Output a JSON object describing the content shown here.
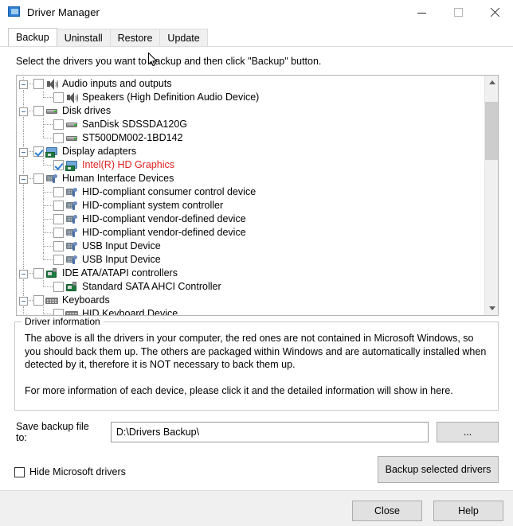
{
  "window": {
    "title": "Driver Manager",
    "icon": "app-window-icon",
    "controls": {
      "minimize": "minimize-icon",
      "maximize": "maximize-icon",
      "close": "close-icon"
    }
  },
  "tabs": [
    {
      "label": "Backup",
      "active": true
    },
    {
      "label": "Uninstall",
      "active": false
    },
    {
      "label": "Restore",
      "active": false
    },
    {
      "label": "Update",
      "active": false
    }
  ],
  "instruction": "Select the drivers you want to backup and then click \"Backup\" button.",
  "tree": {
    "rows": [
      {
        "label": "Audio inputs and outputs",
        "level": 0,
        "checked": false,
        "icon": "speaker-icon",
        "red": false,
        "expander": true
      },
      {
        "label": "Speakers (High Definition Audio Device)",
        "level": 1,
        "checked": false,
        "icon": "speaker-icon",
        "red": false,
        "expander": false
      },
      {
        "label": "Disk drives",
        "level": 0,
        "checked": false,
        "icon": "disk-icon",
        "red": false,
        "expander": true
      },
      {
        "label": "SanDisk SDSSDA120G",
        "level": 1,
        "checked": false,
        "icon": "disk-icon",
        "red": false,
        "expander": false
      },
      {
        "label": "ST500DM002-1BD142",
        "level": 1,
        "checked": false,
        "icon": "disk-icon",
        "red": false,
        "expander": false
      },
      {
        "label": "Display adapters",
        "level": 0,
        "checked": true,
        "icon": "display-adapter-icon",
        "red": false,
        "expander": true
      },
      {
        "label": "Intel(R) HD Graphics",
        "level": 1,
        "checked": true,
        "icon": "display-adapter-icon",
        "red": true,
        "expander": false
      },
      {
        "label": "Human Interface Devices",
        "level": 0,
        "checked": false,
        "icon": "hid-icon",
        "red": false,
        "expander": true
      },
      {
        "label": "HID-compliant consumer control device",
        "level": 1,
        "checked": false,
        "icon": "hid-icon",
        "red": false,
        "expander": false
      },
      {
        "label": "HID-compliant system controller",
        "level": 1,
        "checked": false,
        "icon": "hid-icon",
        "red": false,
        "expander": false
      },
      {
        "label": "HID-compliant vendor-defined device",
        "level": 1,
        "checked": false,
        "icon": "hid-icon",
        "red": false,
        "expander": false
      },
      {
        "label": "HID-compliant vendor-defined device",
        "level": 1,
        "checked": false,
        "icon": "hid-icon",
        "red": false,
        "expander": false
      },
      {
        "label": "USB Input Device",
        "level": 1,
        "checked": false,
        "icon": "hid-icon",
        "red": false,
        "expander": false
      },
      {
        "label": "USB Input Device",
        "level": 1,
        "checked": false,
        "icon": "hid-icon",
        "red": false,
        "expander": false
      },
      {
        "label": "IDE ATA/ATAPI controllers",
        "level": 0,
        "checked": false,
        "icon": "ide-controller-icon",
        "red": false,
        "expander": true
      },
      {
        "label": "Standard SATA AHCI Controller",
        "level": 1,
        "checked": false,
        "icon": "ide-controller-icon",
        "red": false,
        "expander": false
      },
      {
        "label": "Keyboards",
        "level": 0,
        "checked": false,
        "icon": "keyboard-icon",
        "red": false,
        "expander": true
      },
      {
        "label": "HID Keyboard Device",
        "level": 1,
        "checked": false,
        "icon": "keyboard-icon",
        "red": false,
        "expander": false
      }
    ],
    "scroll": {
      "up_arrow": "scroll-up-icon",
      "down_arrow": "scroll-down-icon",
      "thumb_top_pct": 6,
      "thumb_height_pct": 16
    }
  },
  "driver_information": {
    "legend": "Driver information",
    "paragraph1": "The above is all the drivers in your computer, the red ones are not contained in Microsoft Windows, so you should back them up. The others are packaged within Windows and are automatically installed when detected by it, therefore it is NOT necessary to back them up.",
    "paragraph2": "For more information of each device, please click it and the detailed information will show in here."
  },
  "save_row": {
    "label": "Save backup file to:",
    "path_value": "D:\\Drivers Backup\\",
    "path_placeholder": "",
    "browse_label": "..."
  },
  "options": {
    "hide_microsoft_label": "Hide Microsoft drivers",
    "hide_microsoft_checked": false
  },
  "actions": {
    "backup_label": "Backup selected drivers",
    "close_label": "Close",
    "help_label": "Help"
  },
  "colors": {
    "red_driver": "#e32020",
    "checkbox_check": "#2b7fd4",
    "window_bg": "#ffffff",
    "bottom_bar": "#f0f0f0",
    "button_face": "#e1e1e1"
  }
}
